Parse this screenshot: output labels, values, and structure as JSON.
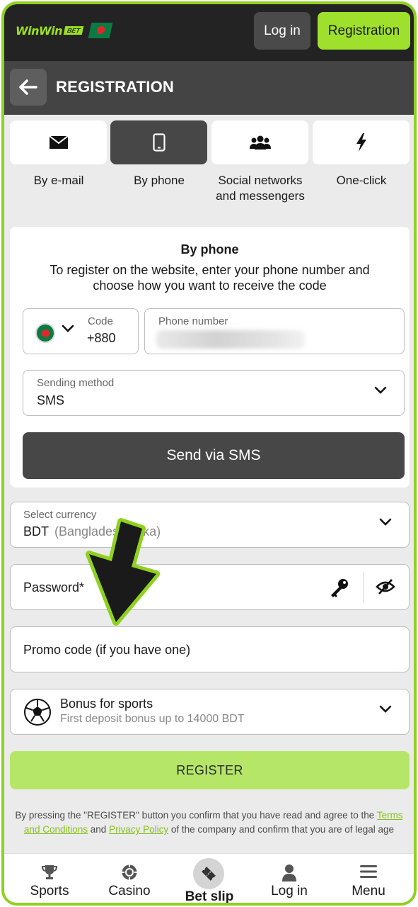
{
  "header": {
    "logo_text": "WinWin",
    "logo_badge": "BET",
    "login_label": "Log in",
    "register_label": "Registration"
  },
  "titlebar": {
    "title": "REGISTRATION",
    "back_icon": "arrow-left-icon"
  },
  "tabs": [
    {
      "label": "By e-mail",
      "icon": "envelope-icon",
      "active": false
    },
    {
      "label": "By phone",
      "icon": "phone-icon",
      "active": true
    },
    {
      "label_line1": "Social networks",
      "label_line2": "and messengers",
      "icon": "users-icon",
      "active": false
    },
    {
      "label": "One-click",
      "icon": "lightning-icon",
      "active": false
    }
  ],
  "phone_form": {
    "title": "By phone",
    "description": "To register on the website, enter your phone number and choose how you want to receive the code",
    "code_label": "Code",
    "code_value": "+880",
    "phone_label": "Phone number",
    "sending_method_label": "Sending method",
    "sending_method_value": "SMS",
    "send_button": "Send via SMS"
  },
  "currency": {
    "label": "Select currency",
    "value": "BDT",
    "value_detail": "(Bangladeshi taka)"
  },
  "password": {
    "placeholder": "Password*"
  },
  "promo": {
    "placeholder": "Promo code (if you have one)"
  },
  "bonus": {
    "title": "Bonus for sports",
    "subtitle": "First deposit bonus up to 14000 BDT"
  },
  "register_button": "REGISTER",
  "legal": {
    "part1": "By pressing the \"REGISTER\" button you confirm that you have read and agree to the",
    "terms_link": "Terms and Conditions",
    "part2": "and",
    "privacy_link": "Privacy Policy",
    "part3": "of the company and confirm that you are of legal age"
  },
  "bottom_nav": [
    {
      "label": "Sports",
      "icon": "trophy-icon"
    },
    {
      "label": "Casino",
      "icon": "casino-chip-icon"
    },
    {
      "label": "Bet slip",
      "icon": "ticket-icon"
    },
    {
      "label": "Log in",
      "icon": "user-icon"
    },
    {
      "label": "Menu",
      "icon": "hamburger-icon"
    }
  ],
  "colors": {
    "accent": "#9fe02c",
    "dark": "#232323",
    "panel": "#444444",
    "frame": "#8fd11f"
  }
}
